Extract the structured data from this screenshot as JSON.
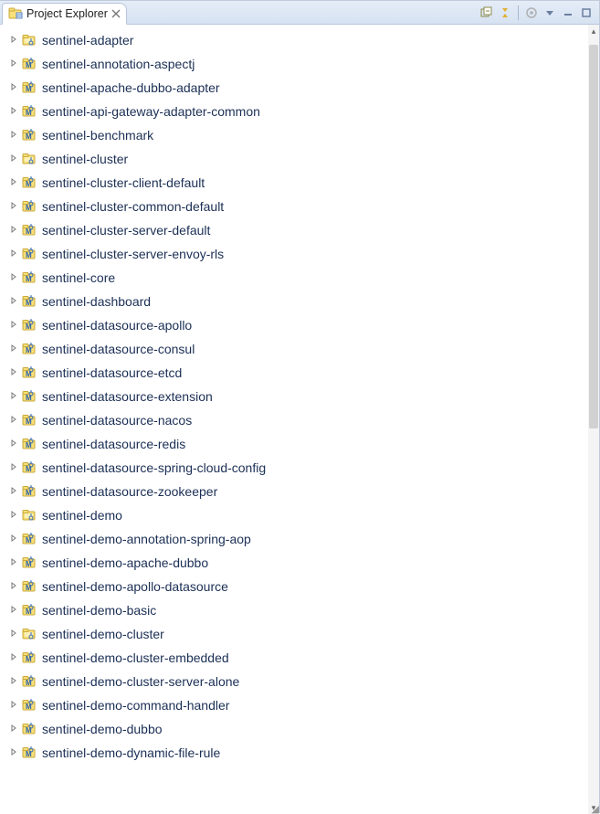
{
  "header": {
    "tab_title": "Project Explorer"
  },
  "tree": {
    "items": [
      {
        "label": "sentinel-adapter",
        "type": "folder"
      },
      {
        "label": "sentinel-annotation-aspectj",
        "type": "maven"
      },
      {
        "label": "sentinel-apache-dubbo-adapter",
        "type": "maven"
      },
      {
        "label": "sentinel-api-gateway-adapter-common",
        "type": "maven"
      },
      {
        "label": "sentinel-benchmark",
        "type": "maven"
      },
      {
        "label": "sentinel-cluster",
        "type": "folder"
      },
      {
        "label": "sentinel-cluster-client-default",
        "type": "maven"
      },
      {
        "label": "sentinel-cluster-common-default",
        "type": "maven"
      },
      {
        "label": "sentinel-cluster-server-default",
        "type": "maven"
      },
      {
        "label": "sentinel-cluster-server-envoy-rls",
        "type": "maven"
      },
      {
        "label": "sentinel-core",
        "type": "maven"
      },
      {
        "label": "sentinel-dashboard",
        "type": "maven"
      },
      {
        "label": "sentinel-datasource-apollo",
        "type": "maven"
      },
      {
        "label": "sentinel-datasource-consul",
        "type": "maven"
      },
      {
        "label": "sentinel-datasource-etcd",
        "type": "maven"
      },
      {
        "label": "sentinel-datasource-extension",
        "type": "maven"
      },
      {
        "label": "sentinel-datasource-nacos",
        "type": "maven"
      },
      {
        "label": "sentinel-datasource-redis",
        "type": "maven"
      },
      {
        "label": "sentinel-datasource-spring-cloud-config",
        "type": "maven"
      },
      {
        "label": "sentinel-datasource-zookeeper",
        "type": "maven"
      },
      {
        "label": "sentinel-demo",
        "type": "folder"
      },
      {
        "label": "sentinel-demo-annotation-spring-aop",
        "type": "maven"
      },
      {
        "label": "sentinel-demo-apache-dubbo",
        "type": "maven"
      },
      {
        "label": "sentinel-demo-apollo-datasource",
        "type": "maven"
      },
      {
        "label": "sentinel-demo-basic",
        "type": "maven"
      },
      {
        "label": "sentinel-demo-cluster",
        "type": "folder"
      },
      {
        "label": "sentinel-demo-cluster-embedded",
        "type": "maven"
      },
      {
        "label": "sentinel-demo-cluster-server-alone",
        "type": "maven"
      },
      {
        "label": "sentinel-demo-command-handler",
        "type": "maven"
      },
      {
        "label": "sentinel-demo-dubbo",
        "type": "maven"
      },
      {
        "label": "sentinel-demo-dynamic-file-rule",
        "type": "maven"
      }
    ]
  }
}
